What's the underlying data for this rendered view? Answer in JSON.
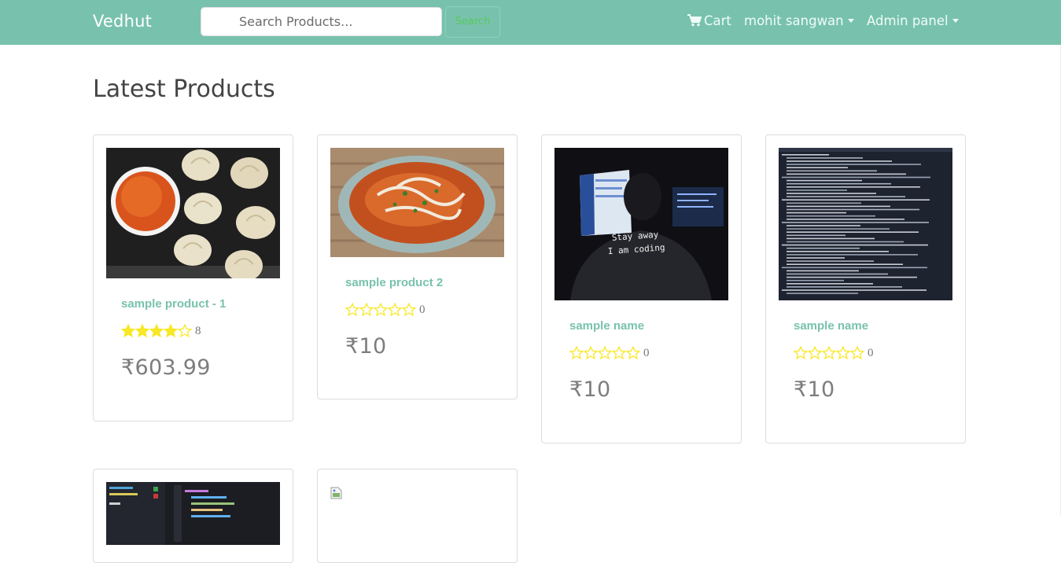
{
  "navbar": {
    "brand": "Vedhut",
    "search_placeholder": "Search Products...",
    "search_button": "Search",
    "cart_label": "Cart",
    "cart_icon": "shopping-cart-icon",
    "user_label": "mohit sangwan",
    "admin_label": "Admin panel"
  },
  "main": {
    "title": "Latest Products",
    "products": [
      {
        "name": "sample product - 1",
        "rating": 4,
        "reviews": "8",
        "price": "₹603.99",
        "image": "momos-with-chutney"
      },
      {
        "name": "sample product 2",
        "rating": 0,
        "reviews": "0",
        "price": "₹10",
        "image": "curry-bowl"
      },
      {
        "name": "sample name",
        "rating": 0,
        "reviews": "0",
        "price": "₹10",
        "image": "stay-away-i-am-coding"
      },
      {
        "name": "sample name",
        "rating": 0,
        "reviews": "0",
        "price": "₹10",
        "image": "terminal-traceback"
      },
      {
        "image": "code-editor"
      },
      {
        "image": "broken-image"
      }
    ]
  },
  "colors": {
    "primary": "#78c2ad",
    "star": "#f8e825",
    "price": "#7d7d7d",
    "title": "#444444"
  },
  "image_text": {
    "shirt_line1": "Stay away",
    "shirt_line2": "I am coding"
  }
}
